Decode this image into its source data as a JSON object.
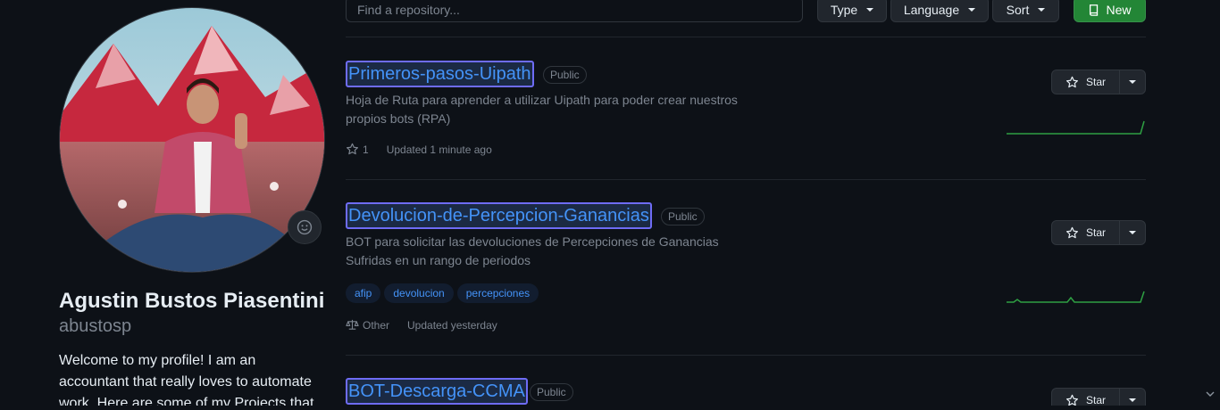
{
  "profile": {
    "full_name": "Agustin Bustos Piasentini",
    "username": "abustosp",
    "bio": "Welcome to my profile! I am an accountant that really loves to automate work. Here are some of my Projects that"
  },
  "filters": {
    "search_placeholder": "Find a repository...",
    "type_label": "Type",
    "language_label": "Language",
    "sort_label": "Sort",
    "new_label": "New"
  },
  "repos": [
    {
      "name": "Primeros-pasos-Uipath",
      "visibility": "Public",
      "description": "Hoja de Ruta para aprender a utilizar Uipath para poder crear nuestros propios bots (RPA)",
      "stars": "1",
      "updated": "Updated 1 minute ago",
      "star_label": "Star"
    },
    {
      "name": "Devolucion-de-Percepcion-Ganancias",
      "visibility": "Public",
      "description": "BOT para solicitar las devoluciones de Percepciones de Ganancias Sufridas en un rango de periodos",
      "topics": [
        "afip",
        "devolucion",
        "percepciones"
      ],
      "license": "Other",
      "updated": "Updated yesterday",
      "star_label": "Star"
    },
    {
      "name": "BOT-Descarga-CCMA",
      "visibility": "Public",
      "star_label": "Star"
    }
  ],
  "colors": {
    "link": "#4493f8",
    "new_button": "#238636",
    "sparkline": "#2ea043"
  }
}
